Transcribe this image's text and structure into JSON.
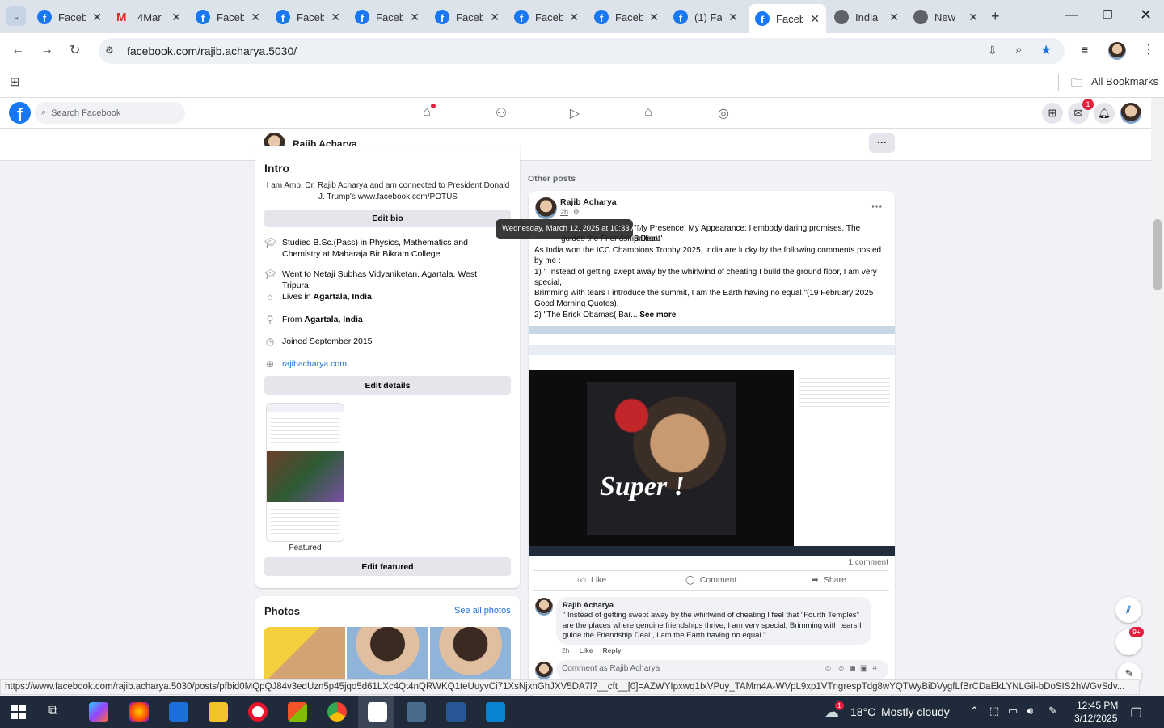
{
  "browser": {
    "tabs": [
      {
        "title": "Faceb"
      },
      {
        "title": "4Mar"
      },
      {
        "title": "Faceb"
      },
      {
        "title": "Faceb"
      },
      {
        "title": "Faceb"
      },
      {
        "title": "Faceb"
      },
      {
        "title": "Faceb"
      },
      {
        "title": "Faceb"
      },
      {
        "title": "(1) Fa"
      },
      {
        "title": "Faceb"
      },
      {
        "title": "India"
      },
      {
        "title": "New"
      }
    ],
    "url": "facebook.com/rajib.acharya.5030/",
    "all_bookmarks": "All Bookmarks"
  },
  "fb_nav": {
    "search_placeholder": "Search Facebook",
    "messenger_badge": "1"
  },
  "profile_bar": {
    "name": "Rajib Acharya"
  },
  "intro": {
    "title": "Intro",
    "bio": "I am Amb. Dr. Rajib Acharya and am connected to President Donald J. Trump's www.facebook.com/POTUS",
    "edit_bio": "Edit bio",
    "rows": [
      {
        "text": "Studied B.Sc.(Pass) in Physics, Mathematics and Chemistry at Maharaja Bir Bikram College"
      },
      {
        "text": "Went to Netaji Subhas Vidyaniketan, Agartala, West Tripura"
      },
      {
        "prefix": "Lives in ",
        "bold": "Agartala, India"
      },
      {
        "prefix": "From ",
        "bold": "Agartala, India"
      },
      {
        "text": "Joined September 2015"
      },
      {
        "link": "rajibacharya.com"
      }
    ],
    "edit_details": "Edit details",
    "featured_label": "Featured",
    "edit_featured": "Edit featured"
  },
  "photos": {
    "title": "Photos",
    "see_all": "See all photos"
  },
  "other_posts_label": "Other posts",
  "post": {
    "author": "Rajib Acharya",
    "time": "2h",
    "tooltip": "Wednesday, March 12, 2025 at 10:33 AM",
    "line1_tail": "\"My Presence, My Appearance: I embody daring promises. The Brilliant",
    "line2_tail": "guides the Friendship Deal.\"",
    "body": [
      "As India won the ICC Champions Trophy 2025, India are lucky by the following comments posted by me :",
      "1) \" Instead of getting swept away by the whirlwind of cheating I build the ground floor, I am very special,",
      "Brimming with tears I introduce the summit, I am the Earth having no equal.\"(19 February 2025 Good Morning Quotes).",
      "2) \"The Brick Obamas( Bar..."
    ],
    "see_more": "See more",
    "image_caption": "Super !",
    "comment_count": "1 comment",
    "like": "Like",
    "comment": "Comment",
    "share": "Share"
  },
  "comment": {
    "author": "Rajib Acharya",
    "text": "\" Instead of getting swept away by the whirlwind of cheating I feel that \"Fourth Temples\" are the places where genuine friendships thrive, I am very special, Brimming with tears I guide the Friendship Deal , I am the Earth having no equal.\"",
    "time": "2h",
    "like": "Like",
    "reply": "Reply",
    "input_placeholder": "Comment as Rajib Acharya"
  },
  "status_url": "https://www.facebook.com/rajib.acharya.5030/posts/pfbid0MQpQJ84v3edUzn5p45jqo5d61LXc4Qt4nQRWKQ1teUuyvCi71XsNjxnGhJXV5DA7l?__cft__[0]=AZWYIpxwq1IxVPuy_TAMm4A-WVpL9xp1VTngrespTdg8wYQTWyBiDVygfLfBrCDaEkLYNLGil-bDoSIS2hWGvSdv...",
  "chat_badge": "9+",
  "taskbar": {
    "weather_temp": "18°C",
    "weather_text": "Mostly cloudy",
    "time": "12:45 PM",
    "date": "3/12/2025",
    "weather_badge": "1"
  }
}
